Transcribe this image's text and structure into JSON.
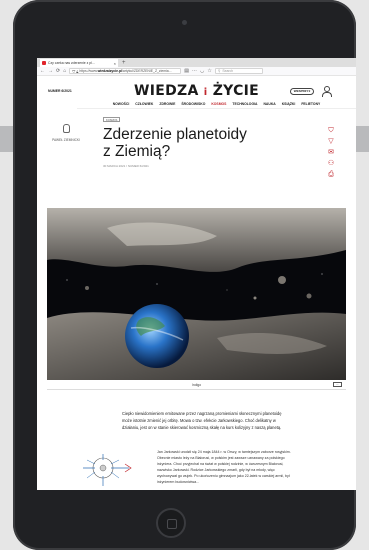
{
  "browser": {
    "tab_title": "Czy czeka nas zderzenie z pl...",
    "tab_close": "×",
    "new_tab": "+",
    "url_prefix": "https://www.",
    "url_domain": "wiedzaizycie.pl",
    "url_path": "/artykul/ZDERZENIE_Z_ziemia...",
    "search_placeholder": "Search",
    "icons": [
      "back-icon",
      "forward-icon",
      "reload-icon",
      "home-icon",
      "shield-icon",
      "lock-icon",
      "bookmark-icon",
      "more-icon",
      "pocket-icon",
      "star-icon",
      "search-icon"
    ]
  },
  "site": {
    "issue_label": "NUMER 6/2021",
    "logo_left": "WIEDZA",
    "logo_sep": "i",
    "logo_right": "ŻYCIE",
    "subscribe_label": "WESPRZYJ",
    "nav": [
      "NOWOŚCI",
      "CZŁOWIEK",
      "ZDROWIE",
      "ŚRODOWISKO",
      "KOSMOS",
      "TECHNOLOGIA",
      "NAUKA",
      "KSIĄŻKI",
      "FELIETONY"
    ],
    "active_nav": "KOSMOS"
  },
  "article": {
    "section_tag": "KOSMOS",
    "title": "Zderzenie planetoidy z Ziemią?",
    "meta": "30 MARCA 2021   /   NUMER 6/2021",
    "author": "PAWEŁ ZIEMNICKI",
    "share_icons": [
      "bookmark-icon",
      "send-icon",
      "mail-icon",
      "share-icon",
      "print-icon"
    ],
    "caption": "Indigo",
    "lead": "Ciepło niewidomieniem emitowane przez nagrzaną promieniami słonecznymi planetoidę może istotnie zmienić jej orbitę. Mowa o tzw. efekcie Jarkowskiego. Choć delikatny w działaniu, jest on w stanie skierować kosmiczną skałę na kurs kolizyjny z naszą planetą.",
    "body": "Jan Jarkowski urodził się 24 maja 1844 r. w Orszy, w tamtejszym zaborze rosyjskim. Obecnie miasto leży na Białorusi, w polskim jest zawsze uznawany za polskiego inżyniera. Choć przyjechał na świat w polskiej rodzinie, w ówczesnym Białorusi, nazwisko Jarkowski. Rodzice Jarkowskiego zmarli, gdy był na młody, więc wychowywał go wujek. Po ukończeniu gimnazjum jako 22-latek w carskiej armii, był inżynierem budownictwa..."
  },
  "colors": {
    "accent": "#c0272d",
    "tablet_frame": "#202124",
    "screen_bg": "#ffffff"
  }
}
